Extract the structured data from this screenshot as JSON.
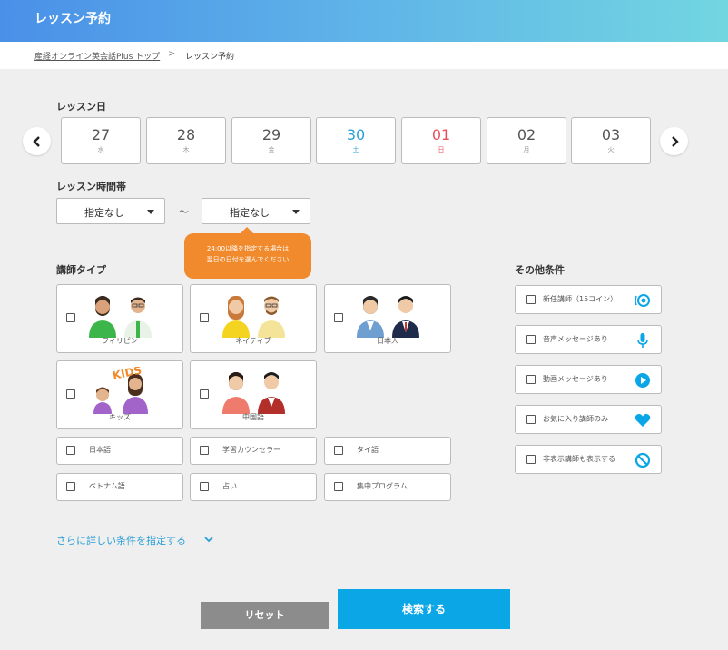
{
  "header": {
    "title": "レッスン予約"
  },
  "breadcrumb": {
    "top_link": "産経オンライン英会話Plus トップ",
    "separator": ">",
    "current": "レッスン予約"
  },
  "lesson_date": {
    "label": "レッスン日",
    "dates": [
      {
        "day": "27",
        "weekday": "水",
        "kind": "weekday"
      },
      {
        "day": "28",
        "weekday": "木",
        "kind": "weekday"
      },
      {
        "day": "29",
        "weekday": "金",
        "kind": "weekday"
      },
      {
        "day": "30",
        "weekday": "土",
        "kind": "saturday"
      },
      {
        "day": "01",
        "weekday": "日",
        "kind": "sunday"
      },
      {
        "day": "02",
        "weekday": "月",
        "kind": "weekday"
      },
      {
        "day": "03",
        "weekday": "火",
        "kind": "weekday"
      }
    ]
  },
  "time_range": {
    "label": "レッスン時間帯",
    "from_value": "指定なし",
    "to_value": "指定なし",
    "separator": "～",
    "tooltip_line1": "24:00以降を指定する場合は",
    "tooltip_line2": "翌日の日付を選んでください"
  },
  "teacher_type": {
    "label": "講師タイプ",
    "illustrated": [
      "フィリピン",
      "ネイティブ",
      "日本人",
      "キッズ",
      "中国語"
    ],
    "kids_badge": "KIDS",
    "plain": [
      "日本語",
      "学習カウンセラー",
      "タイ語",
      "ベトナム語",
      "占い",
      "集中プログラム"
    ]
  },
  "other_conditions": {
    "label": "その他条件",
    "items": [
      {
        "label": "新任講師（15コイン）",
        "icon": "new-teacher-icon"
      },
      {
        "label": "音声メッセージあり",
        "icon": "microphone-icon"
      },
      {
        "label": "動画メッセージあり",
        "icon": "play-icon"
      },
      {
        "label": "お気に入り講師のみ",
        "icon": "heart-icon"
      },
      {
        "label": "非表示講師も表示する",
        "icon": "prohibited-icon"
      }
    ]
  },
  "more_conditions": "さらに詳しい条件を指定する",
  "buttons": {
    "reset": "リセット",
    "search": "検索する"
  },
  "colors": {
    "accent": "#0aa6e6",
    "saturday": "#2a9fd6",
    "sunday": "#e8505b",
    "tooltip": "#f08a2c",
    "reset": "#8c8c8c"
  }
}
